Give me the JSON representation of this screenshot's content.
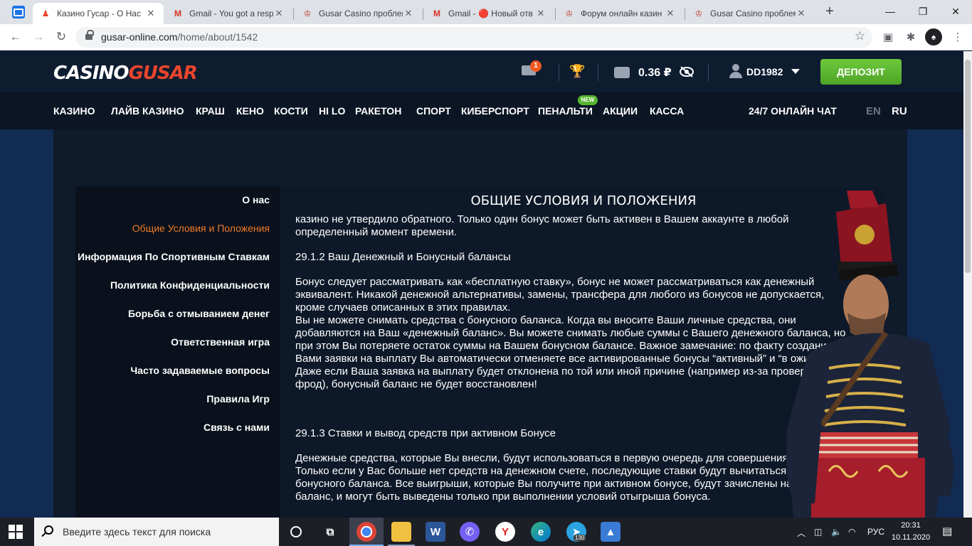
{
  "browser": {
    "tabs": [
      {
        "title": "Казино Гусар - О Нас",
        "active": true
      },
      {
        "title": "Gmail - You got a resp"
      },
      {
        "title": "Gusar Casino проблем"
      },
      {
        "title": "Gmail - 🔴 Новый отв"
      },
      {
        "title": "Форум онлайн казин"
      },
      {
        "title": "Gusar Casino проблем"
      }
    ],
    "new_tab": "+",
    "minimize": "—",
    "restore": "❐",
    "close": "✕",
    "url_host": "gusar-online.com",
    "url_path": "/home/about/1542",
    "profile_initial": "♠"
  },
  "header": {
    "logo_part1": "CASINO",
    "logo_part2": "GUSAR",
    "mail_count": "1",
    "balance": "0.36 ₽",
    "username": "DD1982",
    "deposit_label": "ДЕПОЗИТ"
  },
  "nav": {
    "items": [
      "КАЗИНО",
      "ЛАЙВ КАЗИНО",
      "КРАШ",
      "КЕНО",
      "КОСТИ",
      "HI LO",
      "РАКЕТОН",
      "СПОРТ",
      "КИБЕРСПОРТ",
      "ПЕНАЛЬТИ",
      "АКЦИИ",
      "КАССА"
    ],
    "new_badge": "NEW",
    "chat": "24/7 ОНЛАЙН ЧАТ",
    "lang_en": "EN",
    "lang_ru": "RU"
  },
  "sidebar": {
    "items": [
      {
        "label": "О нас"
      },
      {
        "label": "Общие Условия и Положения",
        "active": true
      },
      {
        "label": "Информация По Спортивным Ставкам"
      },
      {
        "label": "Политика Конфиденциальности"
      },
      {
        "label": "Борьба с отмыванием денег"
      },
      {
        "label": "Ответственная игра"
      },
      {
        "label": "Часто задаваемые вопросы"
      },
      {
        "label": "Правила Игр"
      },
      {
        "label": "Связь с нами"
      }
    ]
  },
  "article": {
    "title": "ОБЩИЕ УСЛОВИЯ И ПОЛОЖЕНИЯ",
    "p0": "казино не утвердило обратного. Только один бонус может быть активен в Вашем аккаунте в любой определенный момент времени.",
    "h1": "29.1.2 Ваш Денежный и Бонусный балансы",
    "p1": "Бонус следует рассматривать как «бесплатную ставку», бонус не может рассматриваться как денежный эквивалент. Никакой денежной альтернативы, замены, трансфера для любого из бонусов не допускается, кроме случаев описанных в этих правилах.",
    "p2": "Вы не можете снимать средства с бонусного баланса. Когда вы вносите Ваши личные средства, они добавляются на Ваш «денежный баланс». Вы можете снимать любые суммы с Вашего денежного баланса, но при этом Вы потеряете остаток суммы на Вашем бонусном балансе. Важное замечание: по факту создания Вами заявки на выплату Вы автоматически отменяете все активированные бонусы “активный” и “в ожидании”). Даже если Ваша заявка на выплату будет отклонена по той или иной причине (например из-за проверки на фрод), бонусный баланс не будет восстановлен!",
    "h2": "29.1.3 Ставки и вывод средств при активном Бонусе",
    "p3": "Денежные средства, которые Вы внесли, будут использоваться в первую очередь для совершения ставок. Только если у Вас больше нет средств на денежном счете, последующие ставки будут вычитаться из бонусного баланса. Все выигрыши, которые Вы получите при активном бонусе, будут зачислены на бонусный баланс, и могут быть выведены только при выполнении условий отыгрыша бонуса."
  },
  "taskbar": {
    "search_placeholder": "Введите здесь текст для поиска",
    "lang": "РУС",
    "time": "20:31",
    "date": "10.11.2020",
    "telegram_badge": "130"
  }
}
